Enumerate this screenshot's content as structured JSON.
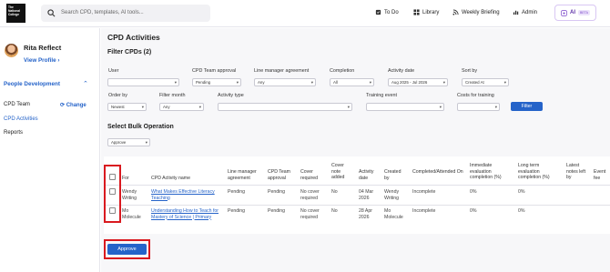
{
  "brand": {
    "logo_text": "The National College"
  },
  "search": {
    "placeholder": "Search CPD, templates, AI tools..."
  },
  "nav": {
    "todo": "To Do",
    "library": "Library",
    "weekly_briefing": "Weekly Briefing",
    "admin": "Admin",
    "ai": "AI",
    "beta": "BETA"
  },
  "sidebar": {
    "user_name": "Rita Reflect",
    "view_profile": "View Profile",
    "section": "People Development",
    "cpd_team_label": "CPD Team",
    "change": "Change",
    "cpd_activities": "CPD Activities",
    "reports": "Reports"
  },
  "page": {
    "title": "CPD Activities"
  },
  "filters": {
    "title": "Filter CPDs (2)",
    "user_label": "User",
    "user_value": "",
    "cpd_team_approval_label": "CPD Team approval",
    "cpd_team_approval_value": "Pending",
    "line_manager_label": "Line manager agreement",
    "line_manager_value": "Any",
    "completion_label": "Completion",
    "completion_value": "All",
    "activity_date_label": "Activity date",
    "activity_date_value": "Aug 2025 - Jul 2026",
    "sort_by_label": "Sort by",
    "sort_by_value": "Created At",
    "order_by_label": "Order by",
    "order_by_value": "Newest",
    "filter_month_label": "Filter month",
    "filter_month_value": "Any",
    "activity_type_label": "Activity type",
    "activity_type_value": "",
    "training_event_label": "Training event",
    "training_event_value": "",
    "costs_label": "Costs for training",
    "costs_value": "",
    "filter_button": "Filter"
  },
  "bulk": {
    "title": "Select Bulk Operation",
    "value": "Approve"
  },
  "table": {
    "headers": {
      "for": "For",
      "name": "CPD Activity name",
      "line_manager": "Line manager agreement",
      "cpd_team": "CPD Team approval",
      "cover_required": "Cover required",
      "cover_note": "Cover note added",
      "activity_date": "Activity date",
      "created_by": "Created by",
      "completed": "Completed/Attended On",
      "immediate": "Immediate evaluation completion (%)",
      "long_term": "Long term evaluation completion (%)",
      "latest_notes": "Latest notes left by",
      "event_fee": "Event fee"
    },
    "rows": [
      {
        "for": "Wendy Writing",
        "name": "What Makes Effective Literacy Teaching",
        "line_manager": "Pending",
        "cpd_team": "Pending",
        "cover_required": "No cover required",
        "cover_note": "No",
        "activity_date": "04 Mar 2026",
        "created_by": "Wendy Writing",
        "completed": "Incomplete",
        "immediate": "0%",
        "long_term": "0%"
      },
      {
        "for": "Mo Molecule",
        "name": "Understanding How to Teach for Mastery of Science | Primary",
        "line_manager": "Pending",
        "cpd_team": "Pending",
        "cover_required": "No cover required",
        "cover_note": "No",
        "activity_date": "28 Apr 2026",
        "created_by": "Mo Molecule",
        "completed": "Incomplete",
        "immediate": "0%",
        "long_term": "0%"
      }
    ]
  },
  "actions": {
    "approve": "Approve"
  },
  "colors": {
    "accent": "#2563c9",
    "highlight": "#d9191f"
  }
}
